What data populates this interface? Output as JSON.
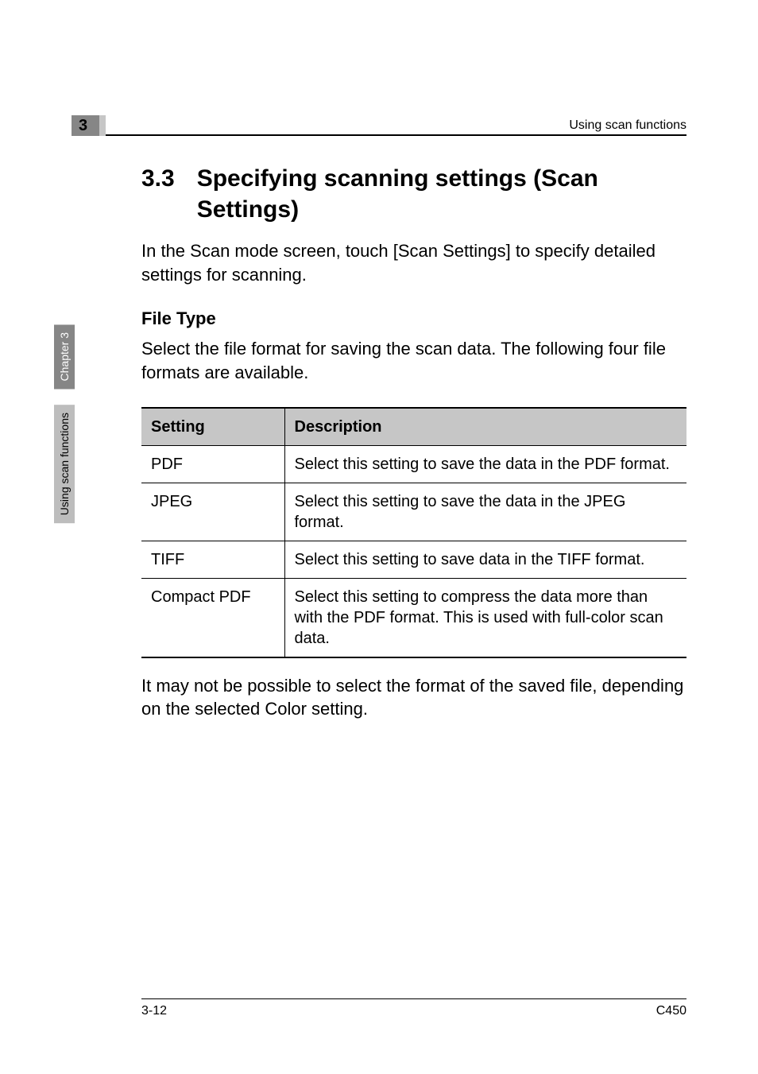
{
  "header": {
    "chapter_number": "3",
    "breadcrumb": "Using scan functions"
  },
  "side_tabs": {
    "tab1": "Chapter 3",
    "tab2": "Using scan functions"
  },
  "section": {
    "number": "3.3",
    "title": "Specifying scanning settings (Scan Settings)",
    "intro": "In the Scan mode screen, touch [Scan Settings] to specify detailed settings for scanning."
  },
  "subsection": {
    "heading": "File Type",
    "intro": "Select the file format for saving the scan data. The following four file formats are available."
  },
  "table": {
    "headers": {
      "col1": "Setting",
      "col2": "Description"
    },
    "rows": [
      {
        "setting": "PDF",
        "description": "Select this setting to save the data in the PDF format."
      },
      {
        "setting": "JPEG",
        "description": "Select this setting to save the data in the JPEG format."
      },
      {
        "setting": "TIFF",
        "description": "Select this setting to save data in the TIFF format."
      },
      {
        "setting": "Compact PDF",
        "description": "Select this setting to compress the data more than with the PDF format. This is used with full-color scan data."
      }
    ]
  },
  "note": "It may not be possible to select the format of the saved file, depending on the selected Color setting.",
  "footer": {
    "page": "3-12",
    "model": "C450"
  }
}
